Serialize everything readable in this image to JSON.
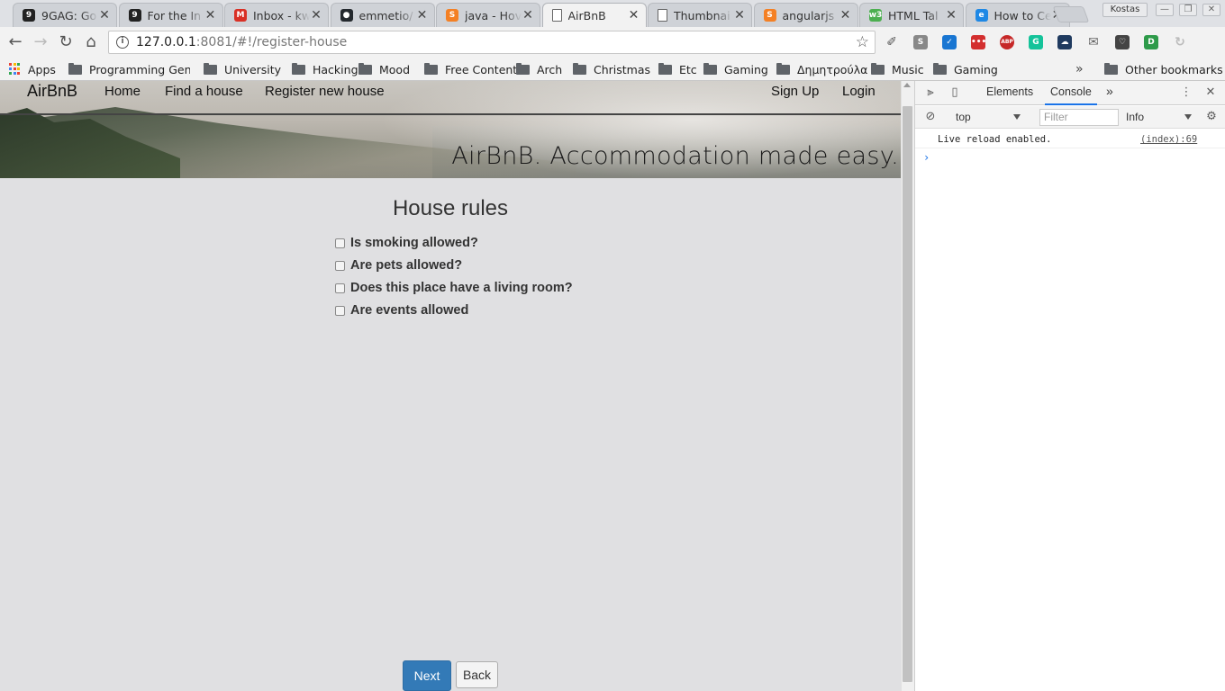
{
  "browser": {
    "tabs": [
      {
        "title": "9GAG: Go",
        "icon": "nine-gag-icon",
        "color": "#222222",
        "glyph": "9"
      },
      {
        "title": "For the In",
        "icon": "nine-gag-icon",
        "color": "#222222",
        "glyph": "9"
      },
      {
        "title": "Inbox - kw",
        "icon": "gmail-icon",
        "color": "#d93025",
        "glyph": "M"
      },
      {
        "title": "emmetio/",
        "icon": "github-icon",
        "color": "#24292e",
        "glyph": "●"
      },
      {
        "title": "java - Hov",
        "icon": "stackoverflow-icon",
        "color": "#f48024",
        "glyph": "S"
      },
      {
        "title": "AirBnB",
        "icon": "page-icon",
        "color": "#ffffff",
        "glyph": ""
      },
      {
        "title": "Thumbnai",
        "icon": "page-icon",
        "color": "#ffffff",
        "glyph": ""
      },
      {
        "title": "angularjs",
        "icon": "stackoverflow-icon",
        "color": "#f48024",
        "glyph": "S"
      },
      {
        "title": "HTML Tal",
        "icon": "w3schools-icon",
        "color": "#4caf50",
        "glyph": "w3"
      },
      {
        "title": "How to Ce",
        "icon": "globe-icon",
        "color": "#1e88e5",
        "glyph": "e"
      }
    ],
    "active_tab_index": 5,
    "profile_name": "Kostas",
    "url_host": "127.0.0.1",
    "url_rest": ":8081/#!/register-house",
    "extensions": [
      {
        "name": "eyedropper-icon",
        "color": "#555555",
        "glyph": "✐"
      },
      {
        "name": "s-extension-icon",
        "color": "#888888",
        "glyph": "S"
      },
      {
        "name": "todo-extension-icon",
        "color": "#1976d2",
        "glyph": "✓"
      },
      {
        "name": "dots-extension-icon",
        "color": "#d32f2f",
        "glyph": "•••"
      },
      {
        "name": "adblock-icon",
        "color": "#c62828",
        "glyph": "ABP"
      },
      {
        "name": "grammarly-icon",
        "color": "#15c39a",
        "glyph": "G"
      },
      {
        "name": "cloud-extension-icon",
        "color": "#1f3a5f",
        "glyph": "☁"
      },
      {
        "name": "mail-icon",
        "color": "#666666",
        "glyph": "✉"
      },
      {
        "name": "pocket-icon",
        "color": "#444444",
        "glyph": "♡"
      },
      {
        "name": "d-extension-icon",
        "color": "#2e9b4a",
        "glyph": "D"
      },
      {
        "name": "sync-extension-icon",
        "color": "#bbbbbb",
        "glyph": "↻"
      }
    ],
    "bookmarks": [
      "Apps",
      "Programming Gener",
      "University",
      "Hacking",
      "Mood",
      "Free Content",
      "Arch",
      "Christmas",
      "Etc",
      "Gaming",
      "Δημητρούλα",
      "Music",
      "Gaming"
    ],
    "other_bookmarks": "Other bookmarks",
    "overflow_label": "»"
  },
  "site": {
    "brand": "AirBnB",
    "nav": [
      "Home",
      "Find a house",
      "Register new house"
    ],
    "nav_right": [
      "Sign Up",
      "Login"
    ],
    "tagline": "AirBnB. Accommodation made easy."
  },
  "form": {
    "title": "House rules",
    "rules": [
      {
        "label": "Is smoking allowed?",
        "checked": false
      },
      {
        "label": "Are pets allowed?",
        "checked": false
      },
      {
        "label": "Does this place have a living room?",
        "checked": false
      },
      {
        "label": "Are events allowed",
        "checked": false
      }
    ],
    "next_label": "Next",
    "back_label": "Back",
    "primary_color": "#337ab7"
  },
  "devtools": {
    "tabs": [
      "Elements",
      "Console"
    ],
    "active_tab": "Console",
    "more_label": "»",
    "context": "top",
    "filter_placeholder": "Filter",
    "level": "Info",
    "messages": [
      {
        "text": "Live reload enabled.",
        "source": "(index):69"
      }
    ],
    "prompt": "›"
  }
}
